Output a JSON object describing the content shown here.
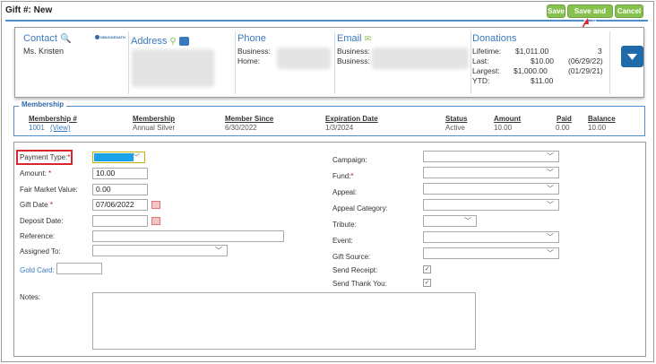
{
  "header": {
    "title": "Gift #: New",
    "buttons": {
      "save": "Save",
      "save_exit": "Save and Exit",
      "cancel": "Cancel"
    }
  },
  "contact": {
    "contact_title": "Contact",
    "contact_name": "Ms. Kristen",
    "badge_text": "DBUCKESATH",
    "address_title": "Address",
    "phone_title": "Phone",
    "phone_business_label": "Business:",
    "phone_home_label": "Home:",
    "email_title": "Email",
    "email_business_label1": "Business:",
    "email_business_label2": "Business:",
    "donations_title": "Donations",
    "donations": {
      "lifetime_label": "Lifetime:",
      "lifetime_amount": "$1,011.00",
      "lifetime_extra": "3",
      "last_label": "Last:",
      "last_amount": "$10.00",
      "last_date": "(06/29/22)",
      "largest_label": "Largest:",
      "largest_amount": "$1,000.00",
      "largest_date": "(01/29/21)",
      "ytd_label": "YTD:",
      "ytd_amount": "$11.00"
    }
  },
  "membership": {
    "legend": "Membership",
    "headers": {
      "number": "Membership #",
      "membership": "Membership",
      "since": "Member Since",
      "expiration": "Expiration Date",
      "status": "Status",
      "amount": "Amount",
      "paid": "Paid",
      "balance": "Balance"
    },
    "row": {
      "number": "1001",
      "view": "(View)",
      "membership": "Annual Silver",
      "since": "6/30/2022",
      "expiration": "1/3/2024",
      "status": "Active",
      "amount": "10.00",
      "paid": "0.00",
      "balance": "10.00"
    }
  },
  "form": {
    "left": {
      "payment_type": "Payment Type:",
      "amount": "Amount:",
      "amount_value": "10.00",
      "fair_market": "Fair Market Value:",
      "fair_market_value": "0.00",
      "gift_date": "Gift Date",
      "gift_date_value": "07/06/2022",
      "deposit_date": "Deposit Date:",
      "reference": "Reference:",
      "assigned_to": "Assigned To:",
      "gold_card": "Gold Card:",
      "notes": "Notes:"
    },
    "right": {
      "campaign": "Campaign:",
      "fund": "Fund:",
      "appeal": "Appeal:",
      "appeal_category": "Appeal Category:",
      "tribute": "Tribute:",
      "event": "Event:",
      "gift_source": "Gift Source:",
      "send_receipt": "Send Receipt:",
      "send_thank_you": "Send Thank You:"
    },
    "checkmark": "✓",
    "required_star": "*",
    "dropdown_arrow": "﹀"
  },
  "colors": {
    "accent_blue": "#3a78bd",
    "button_green": "#86c04e",
    "highlight_red": "#d9262c",
    "payment_type_fill": "#1aa3e8"
  }
}
